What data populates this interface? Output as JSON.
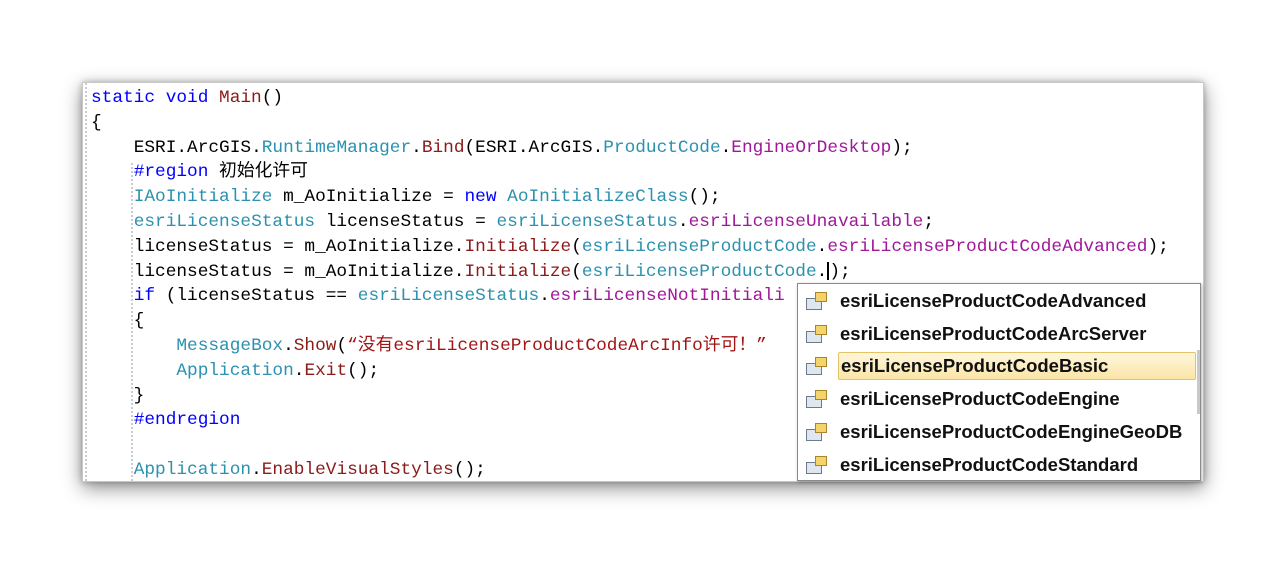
{
  "code_lines": [
    [
      [
        "static void ",
        "kw"
      ],
      [
        "Main",
        "me"
      ],
      [
        "()",
        "id"
      ]
    ],
    [
      [
        "{",
        "id"
      ]
    ],
    [
      [
        "    ",
        "id"
      ],
      [
        "ESRI",
        "id"
      ],
      [
        ".",
        "id"
      ],
      [
        "ArcGIS",
        "id"
      ],
      [
        ".",
        "id"
      ],
      [
        "RuntimeManager",
        "ty"
      ],
      [
        ".",
        "id"
      ],
      [
        "Bind",
        "me"
      ],
      [
        "(",
        "id"
      ],
      [
        "ESRI",
        "id"
      ],
      [
        ".",
        "id"
      ],
      [
        "ArcGIS",
        "id"
      ],
      [
        ".",
        "id"
      ],
      [
        "ProductCode",
        "ty"
      ],
      [
        ".",
        "id"
      ],
      [
        "EngineOrDesktop",
        "en"
      ],
      [
        ");",
        "id"
      ]
    ],
    [
      [
        "    ",
        "id"
      ],
      [
        "#region",
        "pp"
      ],
      [
        " 初始化许可",
        "cn"
      ]
    ],
    [
      [
        "    ",
        "id"
      ],
      [
        "IAoInitialize",
        "ty"
      ],
      [
        " m_AoInitialize = ",
        "id"
      ],
      [
        "new",
        "kw"
      ],
      [
        " ",
        "id"
      ],
      [
        "AoInitializeClass",
        "ty"
      ],
      [
        "();",
        "id"
      ]
    ],
    [
      [
        "    ",
        "id"
      ],
      [
        "esriLicenseStatus",
        "ty"
      ],
      [
        " licenseStatus = ",
        "id"
      ],
      [
        "esriLicenseStatus",
        "ty"
      ],
      [
        ".",
        "id"
      ],
      [
        "esriLicenseUnavailable",
        "en"
      ],
      [
        ";",
        "id"
      ]
    ],
    [
      [
        "    ",
        "id"
      ],
      [
        "licenseStatus = m_AoInitialize.",
        "id"
      ],
      [
        "Initialize",
        "me"
      ],
      [
        "(",
        "id"
      ],
      [
        "esriLicenseProductCode",
        "ty"
      ],
      [
        ".",
        "id"
      ],
      [
        "esriLicenseProductCodeAdvanced",
        "en"
      ],
      [
        ");",
        "id"
      ]
    ],
    [
      [
        "    ",
        "id"
      ],
      [
        "licenseStatus = m_AoInitialize.",
        "id"
      ],
      [
        "Initialize",
        "me"
      ],
      [
        "(",
        "id"
      ],
      [
        "esriLicenseProductCode",
        "ty"
      ],
      [
        ".",
        "id"
      ],
      [
        "|CARET|",
        "caret"
      ],
      [
        ");",
        "id"
      ]
    ],
    [
      [
        "    ",
        "id"
      ],
      [
        "if",
        "kw"
      ],
      [
        " (licenseStatus == ",
        "id"
      ],
      [
        "esriLicenseStatus",
        "ty"
      ],
      [
        ".",
        "id"
      ],
      [
        "esriLicenseNotInitiali",
        "en"
      ]
    ],
    [
      [
        "    {",
        "id"
      ]
    ],
    [
      [
        "        ",
        "id"
      ],
      [
        "MessageBox",
        "ty"
      ],
      [
        ".",
        "id"
      ],
      [
        "Show",
        "me"
      ],
      [
        "(",
        "id"
      ],
      [
        "“没有esriLicenseProductCodeArcInfo许可！”",
        "st"
      ]
    ],
    [
      [
        "        ",
        "id"
      ],
      [
        "Application",
        "ty"
      ],
      [
        ".",
        "id"
      ],
      [
        "Exit",
        "me"
      ],
      [
        "();",
        "id"
      ]
    ],
    [
      [
        "    }",
        "id"
      ]
    ],
    [
      [
        "    ",
        "id"
      ],
      [
        "#endregion",
        "pp"
      ]
    ],
    [
      [
        "",
        "id"
      ]
    ],
    [
      [
        "    ",
        "id"
      ],
      [
        "Application",
        "ty"
      ],
      [
        ".",
        "id"
      ],
      [
        "EnableVisualStyles",
        "me"
      ],
      [
        "();",
        "id"
      ]
    ]
  ],
  "autocomplete": {
    "items": [
      "esriLicenseProductCodeAdvanced",
      "esriLicenseProductCodeArcServer",
      "esriLicenseProductCodeBasic",
      "esriLicenseProductCodeEngine",
      "esriLicenseProductCodeEngineGeoDB",
      "esriLicenseProductCodeStandard"
    ],
    "selected_index": 2,
    "item_icon": "enum-member-icon"
  }
}
